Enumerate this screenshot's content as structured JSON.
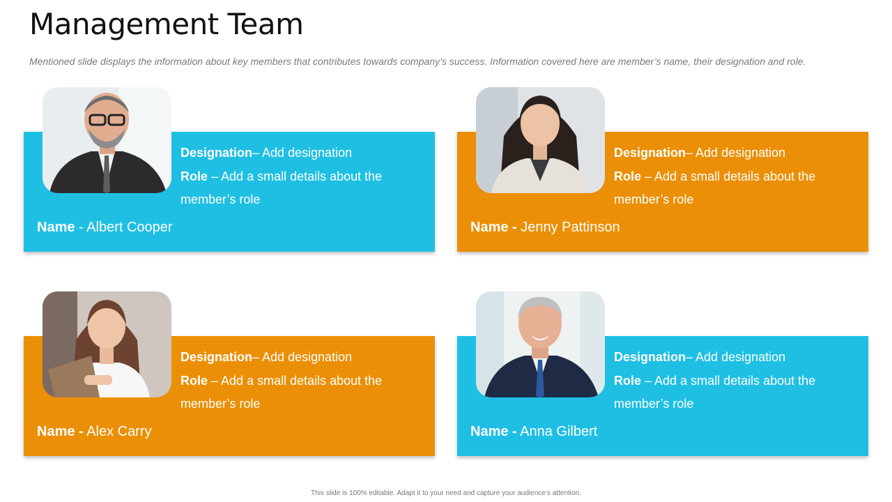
{
  "slide": {
    "title": "Management Team",
    "subtitle": "Mentioned slide displays the information about key members that contributes towards company’s success.  Information covered here are member’s name, their designation and role.",
    "footer": "This slide is 100% editable.  Adapt it to your need and capture your audience’s attention."
  },
  "members": [
    {
      "color": "#1fbfe4",
      "designation_label": "Designation",
      "designation_value": "– Add designation",
      "role_label": "Role",
      "role_value": " – Add a small details about the member’s role",
      "name_label": "Name",
      "name_value": " - Albert  Cooper"
    },
    {
      "color": "#eb8f06",
      "designation_label": "Designation",
      "designation_value": "– Add designation",
      "role_label": "Role",
      "role_value": " – Add a small details about the member’s role",
      "name_label": "Name -",
      "name_value": " Jenny  Pattinson"
    },
    {
      "color": "#eb8f06",
      "designation_label": "Designation",
      "designation_value": "– Add designation",
      "role_label": "Role",
      "role_value": " – Add a small details about the member’s role",
      "name_label": "Name -",
      "name_value": " Alex  Carry"
    },
    {
      "color": "#1fbfe4",
      "designation_label": "Designation",
      "designation_value": "– Add designation",
      "role_label": "Role",
      "role_value": " – Add a small details about the member’s role",
      "name_label": "Name -",
      "name_value": " Anna  Gilbert"
    }
  ]
}
